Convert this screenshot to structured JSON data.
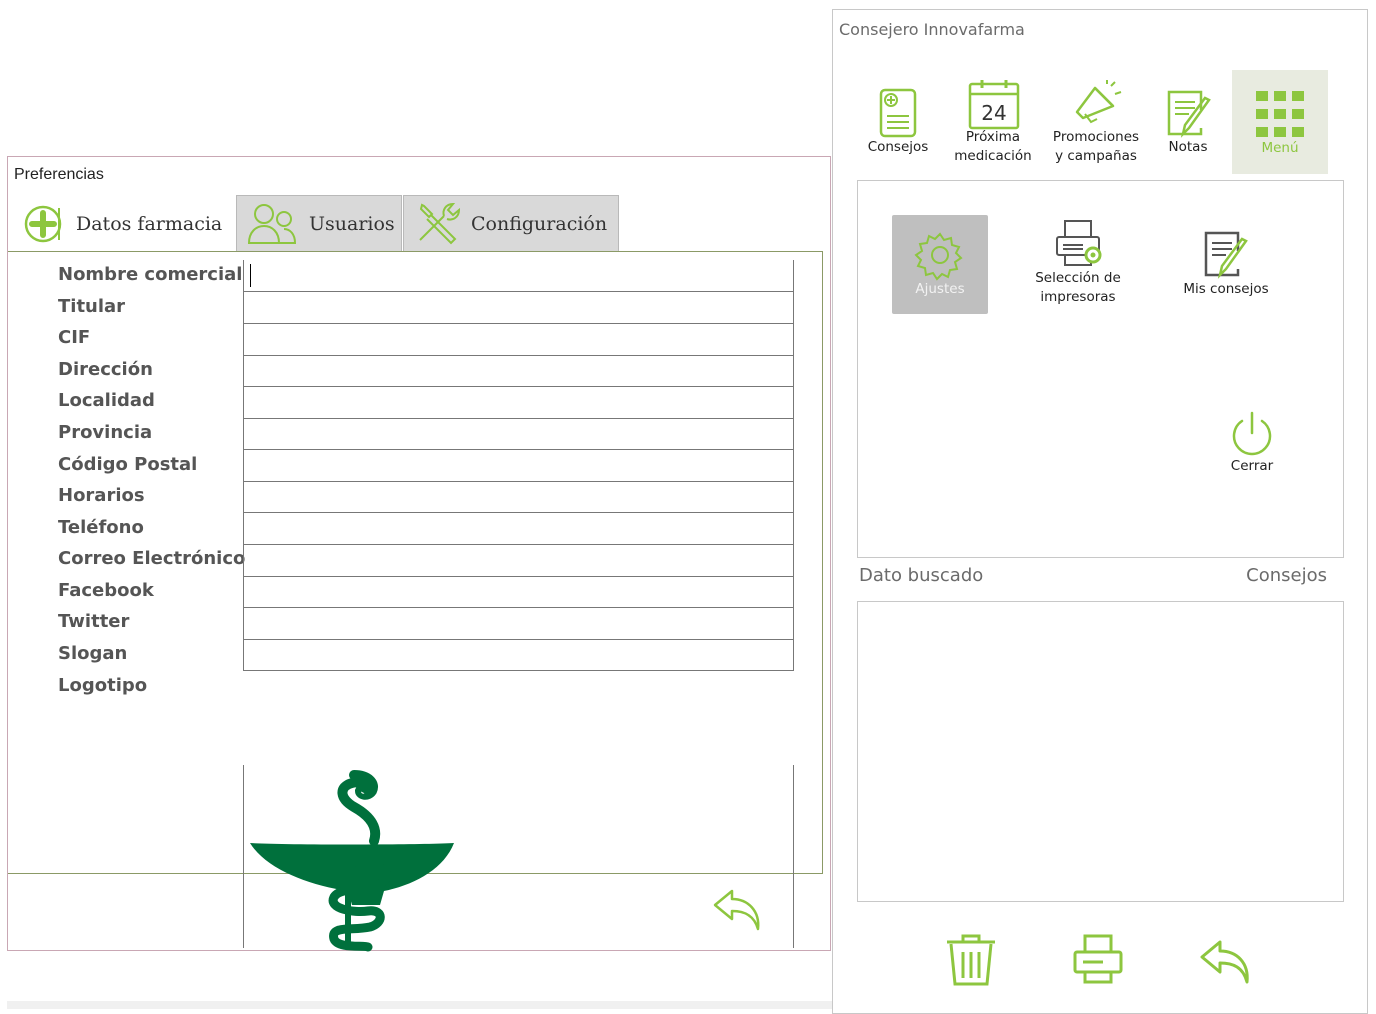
{
  "preferences": {
    "title": "Preferencias",
    "tabs": [
      {
        "label": "Datos farmacia",
        "icon": "plus-circle-icon",
        "active": true
      },
      {
        "label": "Usuarios",
        "icon": "users-icon",
        "active": false
      },
      {
        "label": "Configuración",
        "icon": "tools-icon",
        "active": false
      }
    ],
    "fields": [
      {
        "label": "Nombre comercial",
        "value": ""
      },
      {
        "label": "Titular",
        "value": ""
      },
      {
        "label": "CIF",
        "value": ""
      },
      {
        "label": "Dirección",
        "value": ""
      },
      {
        "label": "Localidad",
        "value": ""
      },
      {
        "label": "Provincia",
        "value": ""
      },
      {
        "label": "Código Postal",
        "value": ""
      },
      {
        "label": "Horarios",
        "value": ""
      },
      {
        "label": "Teléfono",
        "value": ""
      },
      {
        "label": "Correo Electrónico",
        "value": ""
      },
      {
        "label": "Facebook",
        "value": ""
      },
      {
        "label": "Twitter",
        "value": ""
      },
      {
        "label": "Slogan",
        "value": ""
      },
      {
        "label": "Logotipo",
        "value": ""
      }
    ],
    "logo_icon": "pharmacy-bowl-of-hygieia-logo",
    "back_icon": "back-arrow-icon"
  },
  "consejero": {
    "title": "Consejero Innovafarma",
    "toolbar": [
      {
        "label_lines": [
          "Consejos"
        ],
        "icon": "document-plus-icon"
      },
      {
        "label_lines": [
          "Próxima",
          "medicación"
        ],
        "icon": "calendar-icon",
        "calendar_day": "24"
      },
      {
        "label_lines": [
          "Promociones",
          "y campañas"
        ],
        "icon": "megaphone-icon"
      },
      {
        "label_lines": [
          "Notas"
        ],
        "icon": "notes-pencil-icon"
      },
      {
        "label_lines": [
          "Menú"
        ],
        "icon": "grid-menu-icon",
        "selected": true
      }
    ],
    "menu_items": [
      {
        "label_lines": [
          "Ajustes"
        ],
        "icon": "gear-icon",
        "selected": true
      },
      {
        "label_lines": [
          "Selección de",
          "impresoras"
        ],
        "icon": "printer-gear-icon"
      },
      {
        "label_lines": [
          "Mis consejos"
        ],
        "icon": "notes-pencil-icon"
      },
      {
        "label_lines": [
          "Cerrar"
        ],
        "icon": "power-icon"
      }
    ],
    "search_label": "Dato buscado",
    "results_label": "Consejos",
    "bottom_actions": [
      {
        "icon": "trash-icon"
      },
      {
        "icon": "printer-icon"
      },
      {
        "icon": "back-arrow-icon"
      }
    ]
  },
  "colors": {
    "accent_green": "#8dc63f",
    "logo_green": "#00703c",
    "selected_bg": "#e8ebe0",
    "ajustes_bg": "#bfbfbf"
  }
}
